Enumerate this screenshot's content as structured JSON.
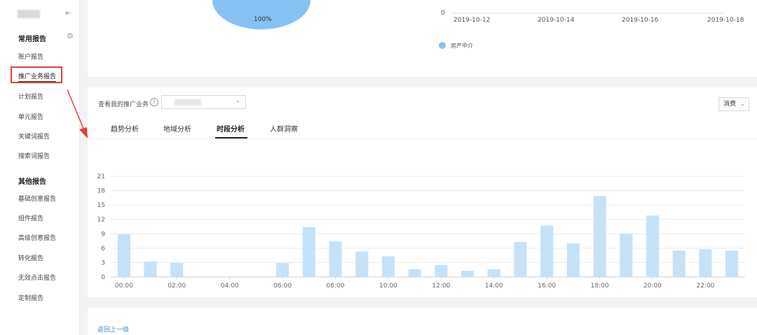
{
  "sidebar": {
    "groups": [
      {
        "title": "常用报告",
        "items": [
          "账户报告",
          "推广业务报告",
          "计划报告",
          "单元报告",
          "关键词报告",
          "搜索词报告"
        ]
      },
      {
        "title": "其他报告",
        "items": [
          "基础创意报告",
          "组件报告",
          "高级创意报告",
          "转化报告",
          "无效点击报告",
          "定制报告"
        ]
      }
    ]
  },
  "top_panel": {
    "pie_label": "100%",
    "mini_axis_zero": "0",
    "mini_dates": [
      "2019-10-12",
      "2019-10-14",
      "2019-10-16",
      "2019-10-18"
    ],
    "legend_label": "房产中介"
  },
  "filter": {
    "label": "查看我的推广业务",
    "help_icon": "?",
    "metric_select": "消费"
  },
  "tabs": [
    "趋势分析",
    "地域分析",
    "时段分析",
    "人群洞察"
  ],
  "active_tab": "时段分析",
  "chart_data": {
    "type": "bar",
    "x": [
      "00:00",
      "01:00",
      "02:00",
      "03:00",
      "04:00",
      "05:00",
      "06:00",
      "07:00",
      "08:00",
      "09:00",
      "10:00",
      "11:00",
      "12:00",
      "13:00",
      "14:00",
      "15:00",
      "16:00",
      "17:00",
      "18:00",
      "19:00",
      "20:00",
      "21:00",
      "22:00",
      "23:00"
    ],
    "values": [
      8.9,
      3.2,
      2.9,
      0,
      0,
      0,
      2.9,
      10.4,
      7.4,
      5.3,
      4.3,
      1.6,
      2.5,
      1.3,
      1.6,
      7.3,
      10.7,
      7.0,
      16.9,
      9.0,
      12.8,
      5.5,
      5.8,
      5.5
    ],
    "x_tick_labels": [
      "00:00",
      "02:00",
      "04:00",
      "06:00",
      "08:00",
      "10:00",
      "12:00",
      "14:00",
      "16:00",
      "18:00",
      "20:00",
      "22:00"
    ],
    "y_ticks": [
      0,
      3,
      6,
      9,
      12,
      15,
      18,
      21
    ],
    "ylim": [
      0,
      21
    ],
    "grid": true,
    "bar_color": "#c6e2f8"
  },
  "footer": {
    "back_link": "返回上一级"
  },
  "colors": {
    "pie": "#86c1f4",
    "annotation_red": "#e0403a",
    "link": "#3b87d6"
  }
}
